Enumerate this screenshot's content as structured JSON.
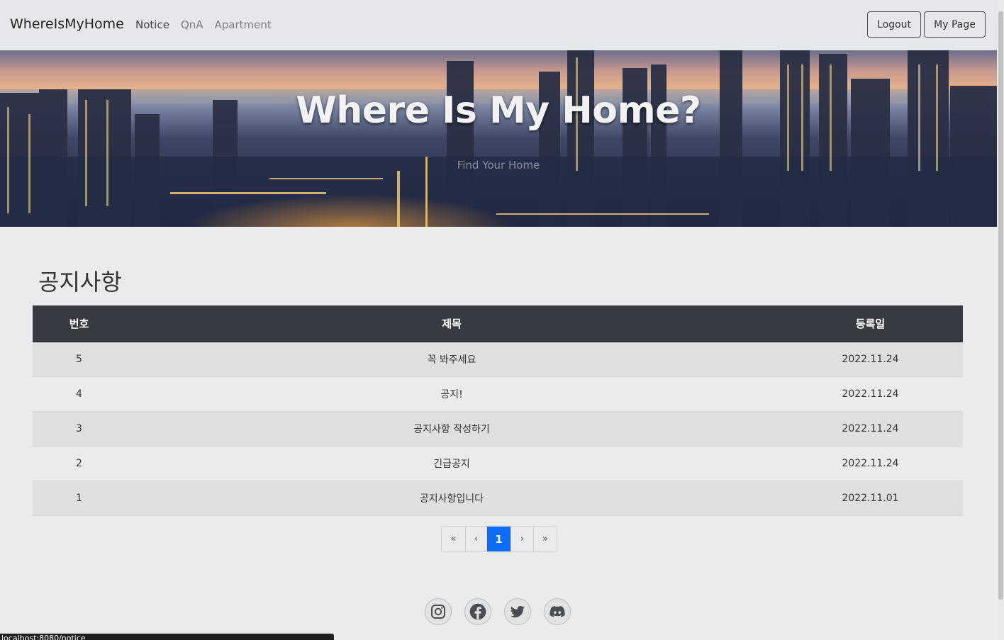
{
  "nav": {
    "brand": "WhereIsMyHome",
    "links": [
      "Notice",
      "QnA",
      "Apartment"
    ],
    "logout_label": "Logout",
    "mypage_label": "My Page"
  },
  "hero": {
    "title": "Where Is My Home?",
    "subtitle": "Find Your Home"
  },
  "notice": {
    "heading": "공지사항",
    "columns": [
      "번호",
      "제목",
      "등록일"
    ],
    "rows": [
      {
        "no": "5",
        "title": "꼭 봐주세요",
        "date": "2022.11.24"
      },
      {
        "no": "4",
        "title": "공지!",
        "date": "2022.11.24"
      },
      {
        "no": "3",
        "title": "공지사항 작성하기",
        "date": "2022.11.24"
      },
      {
        "no": "2",
        "title": "긴급공지",
        "date": "2022.11.24"
      },
      {
        "no": "1",
        "title": "공지사항입니다",
        "date": "2022.11.01"
      }
    ]
  },
  "pagination": {
    "first": "«",
    "prev": "‹",
    "current": "1",
    "next": "›",
    "last": "»"
  },
  "footer": {
    "social_icons": [
      "instagram-icon",
      "facebook-icon",
      "twitter-icon",
      "discord-icon"
    ]
  },
  "status_bar": {
    "url": "localhost:8080/notice"
  },
  "colors": {
    "navbar_bg": "#e5e7ea",
    "table_header_bg": "#373b41",
    "page_active": "#0d6efd",
    "page_bg": "#ebebeb"
  }
}
